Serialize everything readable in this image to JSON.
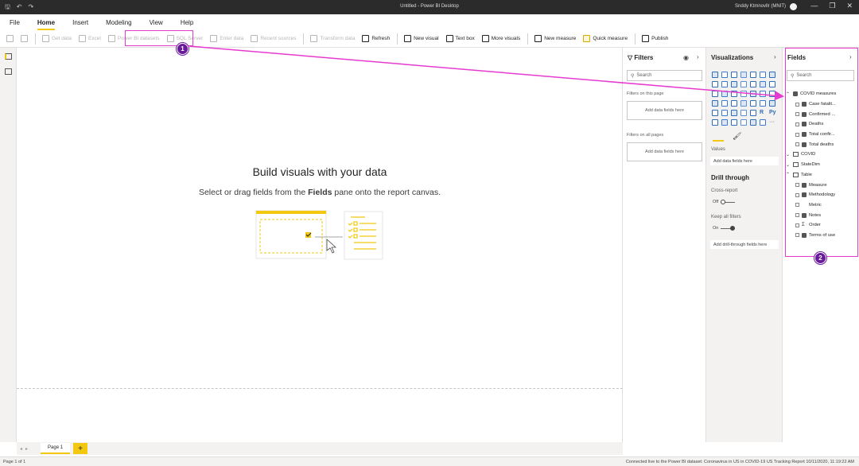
{
  "titlebar": {
    "title": "Untitled - Power BI Desktop",
    "user": "Snddy Ktmnovllr (MNIT)",
    "save_glyph": "🖫",
    "undo_glyph": "↶",
    "redo_glyph": "↷",
    "min_glyph": "—",
    "max_glyph": "❐",
    "close_glyph": "✕"
  },
  "menu": {
    "items": [
      "File",
      "Home",
      "Insert",
      "Modeling",
      "View",
      "Help"
    ],
    "active": "Home"
  },
  "ribbon": {
    "items": [
      {
        "label": "",
        "icon": "paste-icon",
        "disabled": true
      },
      {
        "label": "",
        "icon": "format-painter-icon",
        "disabled": true
      },
      {
        "label": "Get data",
        "icon": "get-data-icon",
        "disabled": true
      },
      {
        "label": "Excel",
        "icon": "excel-icon",
        "disabled": true
      },
      {
        "label": "Power BI datasets",
        "icon": "powerbi-datasets-icon",
        "disabled": true
      },
      {
        "label": "SQL Server",
        "icon": "sql-server-icon",
        "disabled": true
      },
      {
        "label": "Enter data",
        "icon": "enter-data-icon",
        "disabled": true
      },
      {
        "label": "Recent sources",
        "icon": "recent-sources-icon",
        "disabled": true
      },
      {
        "label": "Transform data",
        "icon": "transform-data-icon",
        "disabled": true
      },
      {
        "label": "Refresh",
        "icon": "refresh-icon",
        "disabled": false
      },
      {
        "label": "New visual",
        "icon": "new-visual-icon",
        "disabled": false
      },
      {
        "label": "Text box",
        "icon": "text-box-icon",
        "disabled": false
      },
      {
        "label": "More visuals",
        "icon": "more-visuals-icon",
        "disabled": false
      },
      {
        "label": "New measure",
        "icon": "new-measure-icon",
        "disabled": false
      },
      {
        "label": "Quick measure",
        "icon": "quick-measure-icon",
        "disabled": false
      },
      {
        "label": "Publish",
        "icon": "publish-icon",
        "disabled": false
      }
    ]
  },
  "canvas": {
    "heading": "Build visuals with your data",
    "sub_before": "Select or drag fields from the ",
    "sub_bold": "Fields",
    "sub_after": " pane onto the report canvas."
  },
  "filters": {
    "title": "Filters",
    "search_placeholder": "Search",
    "on_page_label": "Filters on this page",
    "on_all_label": "Filters on all pages",
    "drop_label": "Add data fields here"
  },
  "visualizations": {
    "title": "Visualizations",
    "values_label": "Values",
    "values_drop": "Add data fields here",
    "drill_title": "Drill through",
    "cross_report": "Cross-report",
    "cross_state": "Off",
    "keep_filters": "Keep all filters",
    "keep_state": "On",
    "drill_drop": "Add drill-through fields here",
    "r_label": "R",
    "py_label": "Py",
    "more_label": "···"
  },
  "fields": {
    "title": "Fields",
    "search_placeholder": "Search",
    "tree": [
      {
        "kind": "group",
        "label": "COVID measures",
        "expanded": true,
        "icon": "measure-table-icon"
      },
      {
        "kind": "measure",
        "label": "Case fatalit..."
      },
      {
        "kind": "measure",
        "label": "Confirmed ..."
      },
      {
        "kind": "measure",
        "label": "Deaths"
      },
      {
        "kind": "measure",
        "label": "Total confir..."
      },
      {
        "kind": "measure",
        "label": "Total deaths"
      },
      {
        "kind": "group",
        "label": "COVID",
        "expanded": false,
        "icon": "table-icon"
      },
      {
        "kind": "group",
        "label": "StateDim",
        "expanded": false,
        "icon": "table-icon"
      },
      {
        "kind": "group",
        "label": "Table",
        "expanded": true,
        "icon": "table-icon"
      },
      {
        "kind": "measure",
        "label": "Measure"
      },
      {
        "kind": "measure",
        "label": "Methodology"
      },
      {
        "kind": "column",
        "label": "Metric"
      },
      {
        "kind": "measure",
        "label": "Notes"
      },
      {
        "kind": "sum",
        "label": "Order"
      },
      {
        "kind": "measure",
        "label": "Terms of use"
      }
    ]
  },
  "pages": {
    "tab": "Page 1",
    "add": "+",
    "prev": "◂",
    "next": "▸"
  },
  "status": {
    "left": "Page 1 of 1",
    "right": "Connected live to the Power BI dataset: Coronavirus in US in COVID-19 US Tracking Report 10/11/2020, 11:19:22 AM"
  },
  "annotations": {
    "badge1": "1",
    "badge2": "2",
    "color": "#e63ad0"
  }
}
